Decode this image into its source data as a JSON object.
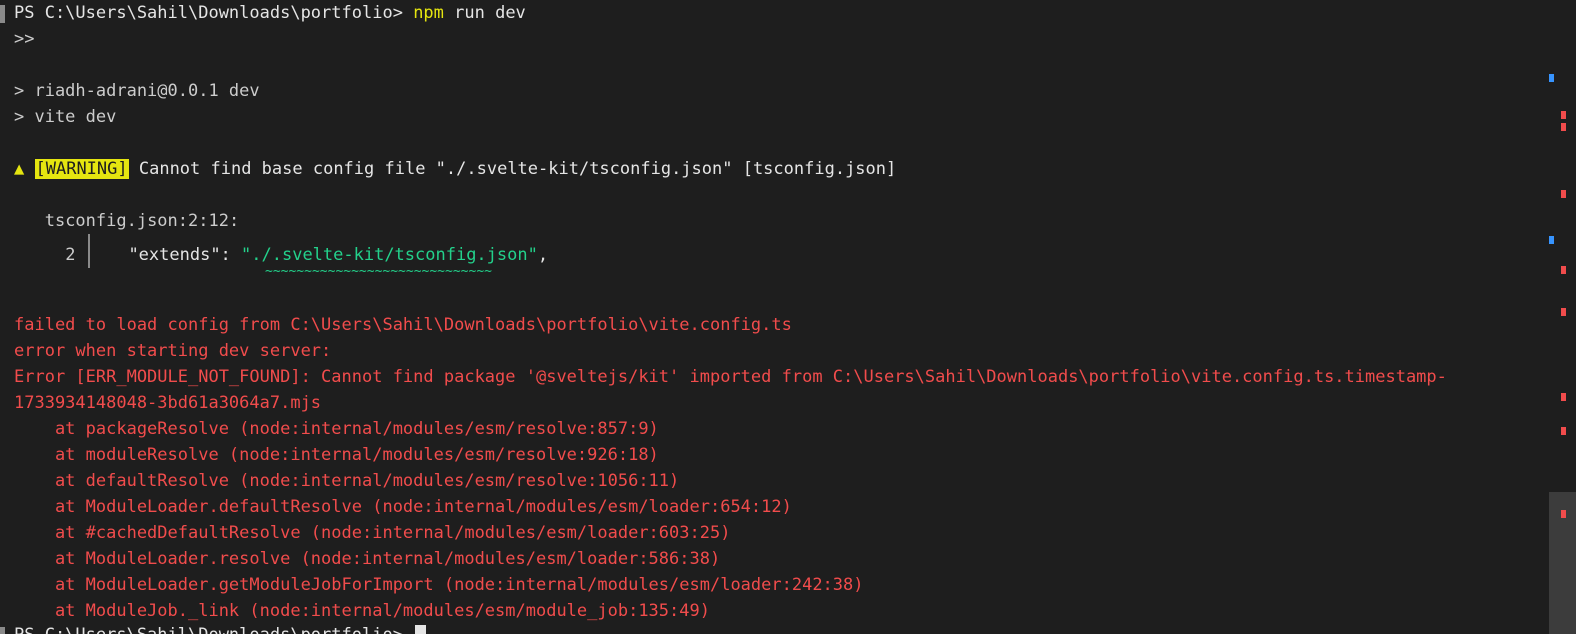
{
  "terminal": {
    "prompt_path": "PS C:\\Users\\Sahil\\Downloads\\portfolio>",
    "command_npm": "npm",
    "command_args": " run dev",
    "continuation": ">>",
    "script_line_1": "> riadh-adrani@0.0.1 dev",
    "script_line_2": "> vite dev",
    "warning_triangle": "▲",
    "warning_badge": "[WARNING]",
    "warning_message": " Cannot find base config file \"./.svelte-kit/tsconfig.json\" [tsconfig.json]",
    "location": "tsconfig.json:2:12:",
    "code_line_number": "2",
    "code_key": "\"extends\": ",
    "code_value": "\"./.svelte-kit/tsconfig.json\"",
    "code_trailing": ",",
    "squiggle": "~~~~~~~~~~~~~~~~~~~~~~~~~~~~~",
    "error_lines": [
      "failed to load config from C:\\Users\\Sahil\\Downloads\\portfolio\\vite.config.ts",
      "error when starting dev server:",
      "Error [ERR_MODULE_NOT_FOUND]: Cannot find package '@sveltejs/kit' imported from C:\\Users\\Sahil\\Downloads\\portfolio\\vite.config.ts.timestamp-",
      "1733934148048-3bd61a3064a7.mjs",
      "    at packageResolve (node:internal/modules/esm/resolve:857:9)",
      "    at moduleResolve (node:internal/modules/esm/resolve:926:18)",
      "    at defaultResolve (node:internal/modules/esm/resolve:1056:11)",
      "    at ModuleLoader.defaultResolve (node:internal/modules/esm/loader:654:12)",
      "    at #cachedDefaultResolve (node:internal/modules/esm/loader:603:25)",
      "    at ModuleLoader.resolve (node:internal/modules/esm/loader:586:38)",
      "    at ModuleLoader.getModuleJobForImport (node:internal/modules/esm/loader:242:38)",
      "    at ModuleJob._link (node:internal/modules/esm/module_job:135:49)"
    ],
    "final_prompt": "PS C:\\Users\\Sahil\\Downloads\\portfolio>"
  },
  "colors": {
    "background": "#1e1e1e",
    "foreground": "#cccccc",
    "warning_yellow": "#e5e510",
    "string_green": "#23d18b",
    "error_red": "#f14c4c",
    "ruler_blue": "#3794ff",
    "ruler_red": "#f14c4c"
  }
}
